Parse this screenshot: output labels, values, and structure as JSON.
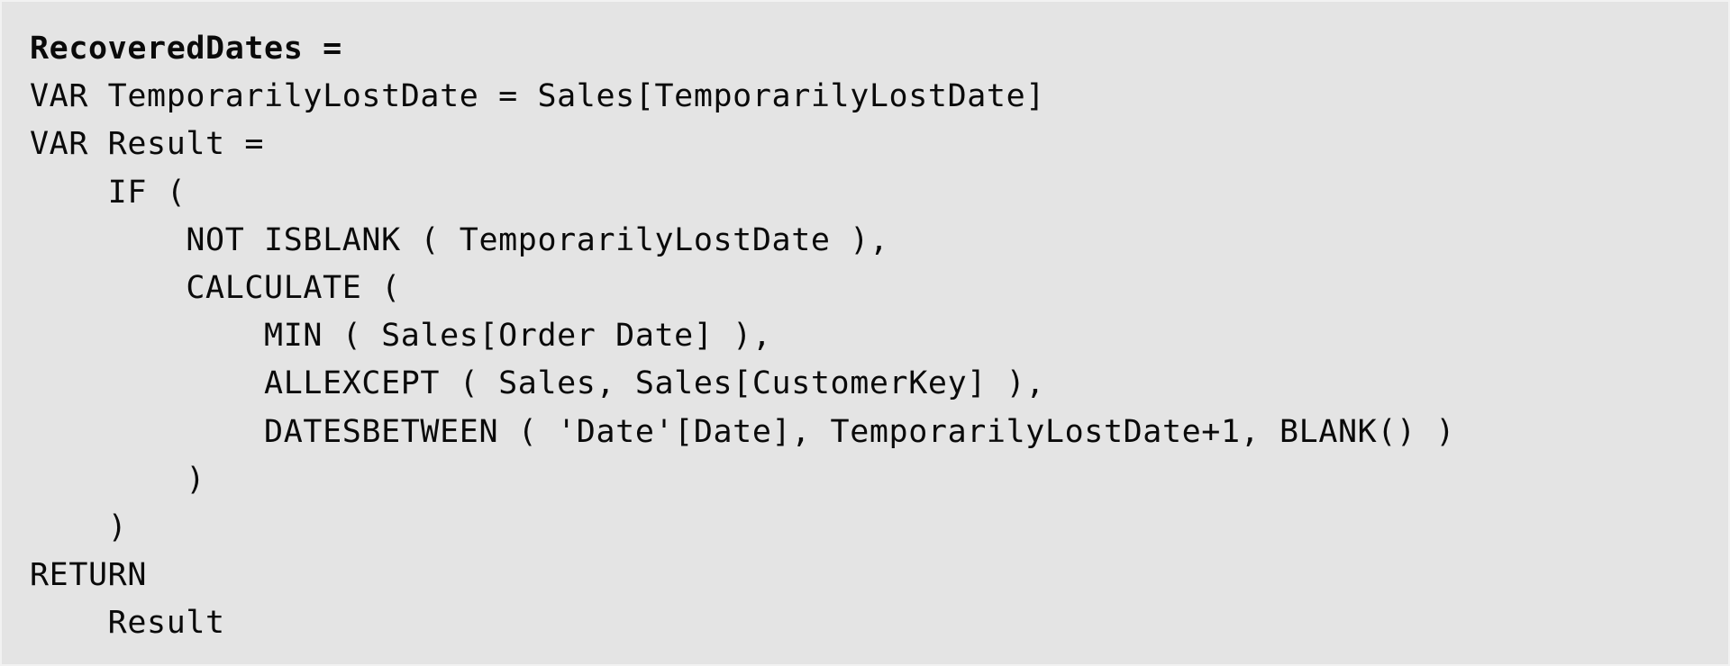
{
  "code": {
    "lines": [
      "RecoveredDates =",
      "VAR TemporarilyLostDate = Sales[TemporarilyLostDate]",
      "VAR Result =",
      "    IF (",
      "        NOT ISBLANK ( TemporarilyLostDate ),",
      "        CALCULATE (",
      "            MIN ( Sales[Order Date] ),",
      "            ALLEXCEPT ( Sales, Sales[CustomerKey] ),",
      "            DATESBETWEEN ( 'Date'[Date], TemporarilyLostDate+1, BLANK() )",
      "        )",
      "    )",
      "RETURN",
      "    Result"
    ]
  }
}
